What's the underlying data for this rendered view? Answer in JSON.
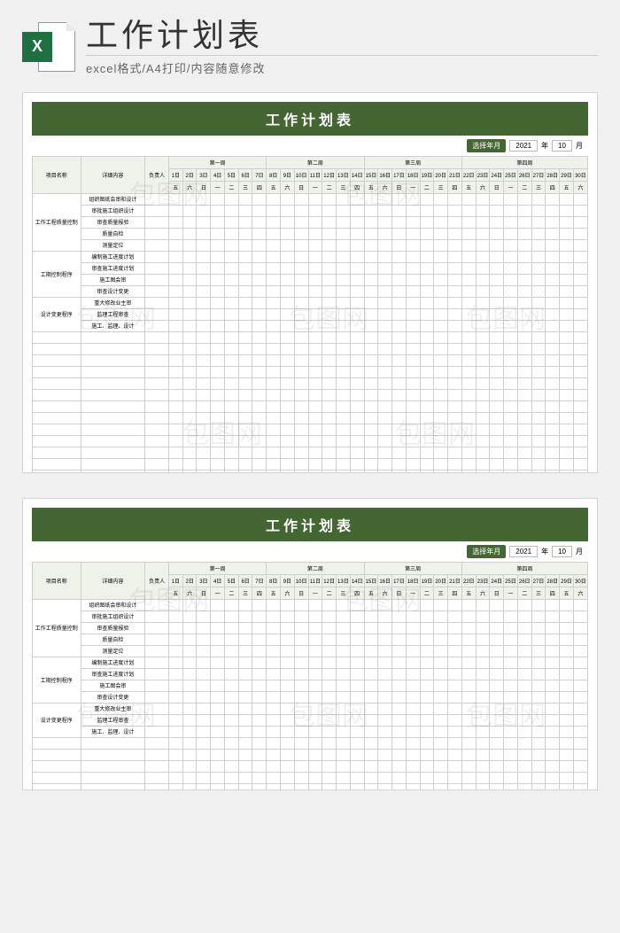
{
  "header": {
    "icon_letter": "X",
    "title": "工作计划表",
    "subtitle": "excel格式/A4打印/内容随意修改"
  },
  "sheet": {
    "title": "工作计划表",
    "picker": {
      "label": "选择年月",
      "year": "2021",
      "year_suffix": "年",
      "month": "10",
      "month_suffix": "月"
    },
    "columns": {
      "project": "项目名称",
      "detail": "详细内容",
      "owner": "负责人"
    },
    "weeks": [
      "第一周",
      "第二周",
      "第三周",
      "第四周"
    ],
    "days": [
      "1日",
      "2日",
      "3日",
      "4日",
      "5日",
      "6日",
      "7日",
      "8日",
      "9日",
      "10日",
      "11日",
      "12日",
      "13日",
      "14日",
      "15日",
      "16日",
      "17日",
      "18日",
      "19日",
      "20日",
      "21日",
      "22日",
      "23日",
      "24日",
      "25日",
      "26日",
      "27日",
      "28日",
      "29日",
      "30日"
    ],
    "weekdays": [
      "五",
      "六",
      "日",
      "一",
      "二",
      "三",
      "四",
      "五",
      "六",
      "日",
      "一",
      "二",
      "三",
      "四",
      "五",
      "六",
      "日",
      "一",
      "二",
      "三",
      "四",
      "五",
      "六",
      "日",
      "一",
      "二",
      "三",
      "四",
      "五",
      "六"
    ],
    "projects": [
      {
        "name": "工作工程质量控制",
        "details": [
          "组织图纸会审和设计",
          "审批施工组织设计",
          "审查质量报验",
          "质量自检",
          "测量定位"
        ]
      },
      {
        "name": "工期控制程序",
        "details": [
          "编制施工进度计划",
          "审查施工进度计划",
          "施工图会审",
          "审查设计变更"
        ]
      },
      {
        "name": "设计变更程序",
        "details": [
          "重大修改业主审",
          "监理工程审查",
          "施工、监理、设计"
        ]
      }
    ],
    "empty_rows": 16
  },
  "watermark": "包图网"
}
